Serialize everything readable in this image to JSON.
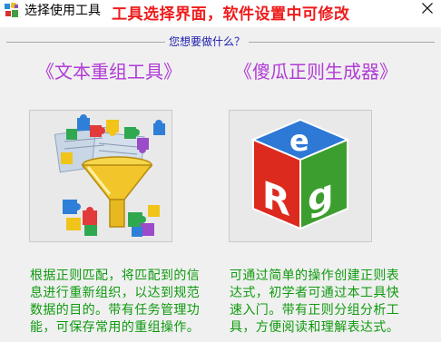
{
  "window": {
    "title": "选择使用工具",
    "banner": "工具选择界面，软件设置中可修改"
  },
  "group": {
    "title": "您想要做什么？"
  },
  "tools": [
    {
      "title": "《文本重组工具》",
      "icon": "funnel-puzzle-icon",
      "description": "根据正则匹配，将匹配到的信息进行重新组织，以达到规范数据的目的。带有任务管理功能，可保存常用的重组操作。"
    },
    {
      "title": "《傻瓜正则生成器》",
      "icon": "regex-cube-icon",
      "description": "可通过简单的操作创建正则表达式，初学者可通过本工具快速入门。带有正则分组分析工具，方便阅读和理解表达式。"
    }
  ],
  "colors": {
    "banner": "#ee1c1c",
    "group_title": "#1a1ab0",
    "tool_title": "#b13bd6",
    "description": "#0f9a0f"
  }
}
